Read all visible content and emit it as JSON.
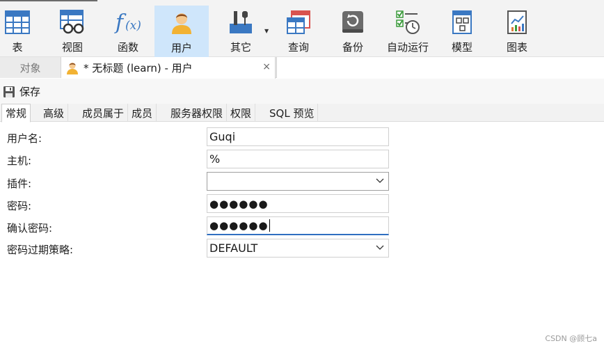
{
  "ribbon": {
    "items": [
      {
        "label": "表",
        "icon": "table-icon"
      },
      {
        "label": "视图",
        "icon": "view-icon"
      },
      {
        "label": "函数",
        "icon": "function-icon"
      },
      {
        "label": "用户",
        "icon": "user-icon",
        "active": true
      },
      {
        "label": "其它",
        "icon": "tools-icon"
      },
      {
        "label": "查询",
        "icon": "query-icon"
      },
      {
        "label": "备份",
        "icon": "backup-icon"
      },
      {
        "label": "自动运行",
        "icon": "schedule-icon"
      },
      {
        "label": "模型",
        "icon": "model-icon"
      },
      {
        "label": "图表",
        "icon": "chart-icon"
      }
    ]
  },
  "tabs": {
    "objects_label": "对象",
    "document_title": "* 无标题 (learn) - 用户",
    "close_glyph": "×"
  },
  "toolbar": {
    "save_label": "保存"
  },
  "subtabs": [
    "常规",
    "高级",
    "成员属于",
    "成员",
    "服务器权限",
    "权限",
    "SQL 预览"
  ],
  "form": {
    "username": {
      "label": "用户名:",
      "value": "Guqi"
    },
    "host": {
      "label": "主机:",
      "value": "%"
    },
    "plugin": {
      "label": "插件:",
      "value": ""
    },
    "password": {
      "label": "密码:",
      "value": "●●●●●●"
    },
    "confirm_password": {
      "label": "确认密码:",
      "value": "●●●●●●"
    },
    "password_policy": {
      "label": "密码过期策略:",
      "value": "DEFAULT"
    }
  },
  "watermark": "CSDN @顾七a",
  "colors": {
    "active_tab_bg": "#cfe6fb",
    "focus_underline": "#2f6fc1"
  }
}
